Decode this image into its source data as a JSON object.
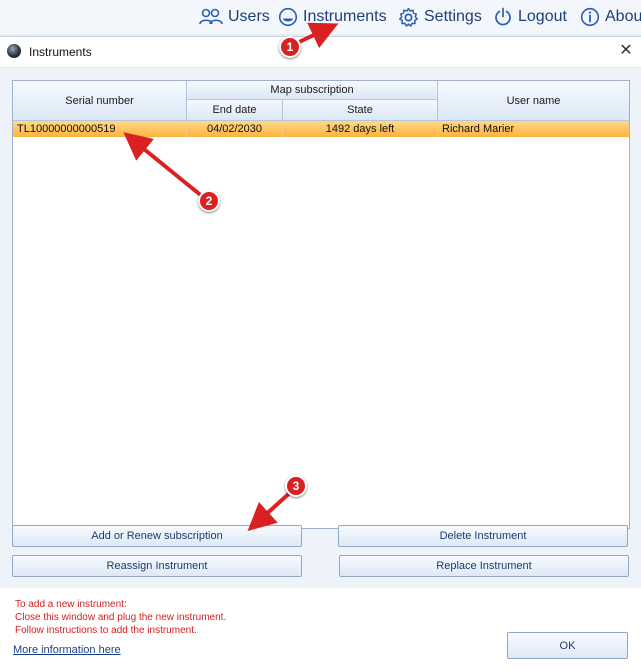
{
  "nav": {
    "users": "Users",
    "instruments": "Instruments",
    "settings": "Settings",
    "logout": "Logout",
    "about": "About"
  },
  "dialog": {
    "title": "Instruments"
  },
  "table": {
    "headers": {
      "serial": "Serial number",
      "map_subscription": "Map subscription",
      "end_date": "End date",
      "state": "State",
      "user_name": "User name"
    },
    "rows": [
      {
        "serial": "TL10000000000519",
        "end_date": "04/02/2030",
        "state": "1492 days left",
        "user": "Richard Marier"
      }
    ]
  },
  "buttons": {
    "add_renew": "Add or Renew subscription",
    "delete": "Delete Instrument",
    "reassign": "Reassign Instrument",
    "replace": "Replace Instrument",
    "ok": "OK"
  },
  "info": {
    "line1": "To add a new instrument:",
    "line2": "Close this window and plug the new instrument.",
    "line3": "Follow instructions to add the instrument.",
    "more_link": "More  information here"
  },
  "annotations": {
    "marker1": "1",
    "marker2": "2",
    "marker3": "3",
    "color": "#d92121"
  },
  "colors": {
    "nav_text": "#1e3f78",
    "selected_row": "#fbb43e",
    "info_text": "#d41f1f"
  }
}
